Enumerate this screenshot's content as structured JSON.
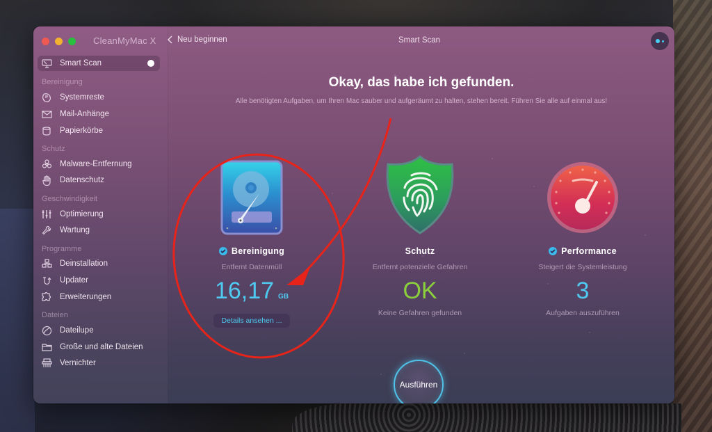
{
  "window": {
    "app_title": "CleanMyMac X",
    "traffic_lights": [
      "close",
      "minimize",
      "maximize"
    ]
  },
  "toolbar": {
    "back_label": "Neu beginnen",
    "page_title": "Smart Scan",
    "assistant_icon": "assistant-icon"
  },
  "sidebar": {
    "active": {
      "label": "Smart Scan",
      "icon": "monitor-scan-icon"
    },
    "sections": [
      {
        "title": "Bereinigung",
        "items": [
          {
            "label": "Systemreste",
            "icon": "system-junk-icon"
          },
          {
            "label": "Mail-Anhänge",
            "icon": "mail-icon"
          },
          {
            "label": "Papierkörbe",
            "icon": "trash-bin-icon"
          }
        ]
      },
      {
        "title": "Schutz",
        "items": [
          {
            "label": "Malware-Entfernung",
            "icon": "biohazard-icon"
          },
          {
            "label": "Datenschutz",
            "icon": "hand-icon"
          }
        ]
      },
      {
        "title": "Geschwindigkeit",
        "items": [
          {
            "label": "Optimierung",
            "icon": "sliders-icon"
          },
          {
            "label": "Wartung",
            "icon": "wrench-icon"
          }
        ]
      },
      {
        "title": "Programme",
        "items": [
          {
            "label": "Deinstallation",
            "icon": "uninstaller-icon"
          },
          {
            "label": "Updater",
            "icon": "updater-icon"
          },
          {
            "label": "Erweiterungen",
            "icon": "puzzle-icon"
          }
        ]
      },
      {
        "title": "Dateien",
        "items": [
          {
            "label": "Dateilupe",
            "icon": "space-lens-icon"
          },
          {
            "label": "Große und alte Dateien",
            "icon": "folder-icon"
          },
          {
            "label": "Vernichter",
            "icon": "shredder-icon"
          }
        ]
      }
    ]
  },
  "main": {
    "headline": "Okay, das habe ich gefunden.",
    "subline": "Alle benötigten Aufgaben, um Ihren Mac sauber und aufgeräumt zu halten, stehen bereit. Führen Sie alle auf einmal aus!",
    "cards": [
      {
        "title": "Bereinigung",
        "checked": true,
        "description": "Entfernt Datenmüll",
        "value": "16,17",
        "unit": "GB",
        "value_color": "#4fc9ef",
        "action_label": "Details ansehen ...",
        "icon": "hard-drive-icon"
      },
      {
        "title": "Schutz",
        "checked": false,
        "description": "Entfernt potenzielle Gefahren",
        "value": "OK",
        "value_color": "#8ccf3c",
        "footer": "Keine Gefahren gefunden",
        "icon": "shield-fingerprint-icon"
      },
      {
        "title": "Performance",
        "checked": true,
        "description": "Steigert die Systemleistung",
        "value": "3",
        "value_color": "#4fc9ef",
        "footer": "Aufgaben auszuführen",
        "icon": "speedometer-icon"
      }
    ],
    "run_label": "Ausführen"
  },
  "annotations": {
    "color": "#e8241a",
    "shapes": [
      "circle around Bereinigung card",
      "arrow pointing to 16,17 GB"
    ]
  }
}
